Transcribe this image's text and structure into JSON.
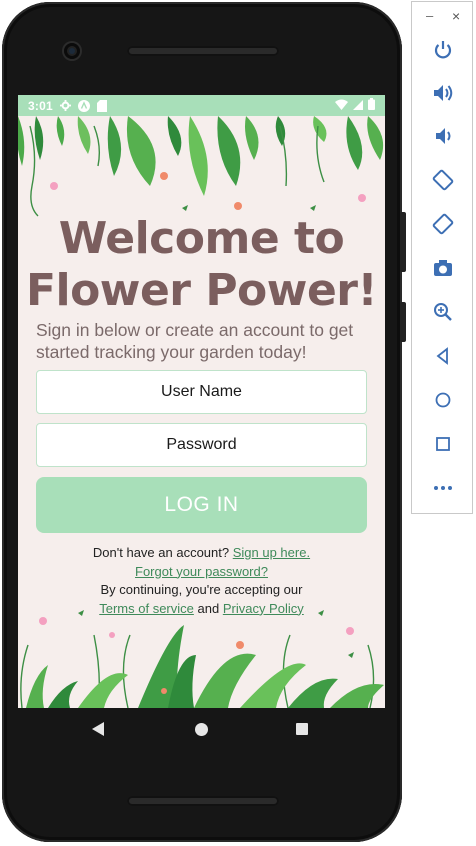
{
  "status_bar": {
    "time": "3:01"
  },
  "app": {
    "title_line1": "Welcome to",
    "title_line2": "Flower Power!",
    "subtitle": "Sign in below or create an account to get started tracking your garden today!",
    "username_placeholder": "User Name",
    "password_placeholder": "Password",
    "login_label": "LOG IN",
    "no_account_text": "Don't have an account?",
    "signup_link": "Sign up here.",
    "forgot_password_link": "Forgot your password?",
    "terms_prefix": "By continuing, you're accepting our",
    "terms_link": "Terms of service",
    "and_text": "and",
    "privacy_link": "Privacy Policy"
  },
  "emulator_toolbar": {
    "minimize": "–",
    "close": "×",
    "icons": [
      "power-icon",
      "volume-up-icon",
      "volume-down-icon",
      "rotate-left-icon",
      "rotate-right-icon",
      "camera-icon",
      "zoom-icon",
      "back-icon",
      "home-icon",
      "overview-icon",
      "more-icon"
    ]
  },
  "colors": {
    "accent_green": "#a8dfb9",
    "title_brown": "#7b5e5e",
    "link_green": "#3f8a5a",
    "screen_bg": "#f6eeec"
  }
}
